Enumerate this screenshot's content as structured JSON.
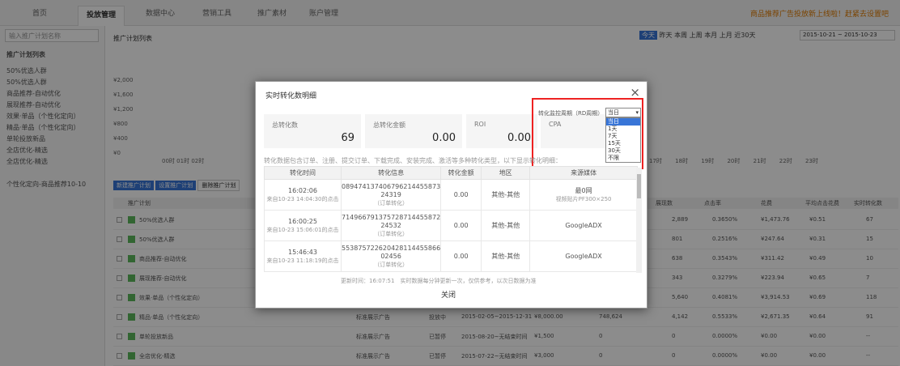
{
  "topnav": {
    "tabs": [
      "首页",
      "投放管理",
      "数据中心",
      "营销工具",
      "推广素材",
      "账户管理"
    ],
    "notice": "商品推荐广告投放新上线啦！赶紧去设置吧"
  },
  "sidebar": {
    "search_placeholder": "输入推广计划名称",
    "items": [
      "推广计划列表",
      "50%优选人群",
      "50%优选人群",
      "商品推荐-自动优化",
      "展现推荐-自动优化",
      "效果·单品（个性化定向）",
      "精品·单品（个性化定向）",
      "单轮投放新品",
      "全店优化-精选",
      "全店优化-精选",
      "个性化定向-商品推荐10-10"
    ]
  },
  "main": {
    "title": "推广计划列表",
    "range_buttons": [
      "今天",
      "昨天",
      "本周",
      "上周",
      "本月",
      "上月",
      "近30天"
    ],
    "date_range": "2015-10-21 ~ 2015-10-23",
    "y_ticks": [
      "¥2,000",
      "¥1,600",
      "¥1,200",
      "¥800",
      "¥400",
      "¥0"
    ],
    "hours": [
      "00时",
      "01时",
      "02时",
      "17时",
      "18时",
      "19时",
      "20时",
      "21时",
      "22时",
      "23时"
    ],
    "buttons": [
      "新建推广计划",
      "设置推广计划",
      "删除推广计划"
    ],
    "columns": [
      "推广计划",
      "投放类型",
      "状态",
      "投放日期",
      "日预算",
      "消耗",
      "展现数",
      "点击率",
      "花费",
      "平均点击花费",
      "实时转化数"
    ],
    "rows": [
      {
        "name": "50%优选人群",
        "show": "2,889",
        "ctr": "0.3650%",
        "cost": "¥1,473.76",
        "cpc": "¥0.51",
        "conv": "67"
      },
      {
        "name": "50%优选人群",
        "show": "801",
        "ctr": "0.2516%",
        "cost": "¥247.64",
        "cpc": "¥0.31",
        "conv": "15"
      },
      {
        "name": "商品推荐-自动优化",
        "show": "638",
        "ctr": "0.3543%",
        "cost": "¥311.42",
        "cpc": "¥0.49",
        "conv": "10"
      },
      {
        "name": "展现推荐-自动优化",
        "show": "343",
        "ctr": "0.3279%",
        "cost": "¥223.94",
        "cpc": "¥0.65",
        "conv": "7"
      },
      {
        "name": "效果·单品（个性化定向）",
        "show": "5,640",
        "ctr": "0.4081%",
        "cost": "¥3,914.53",
        "cpc": "¥0.69",
        "conv": "118"
      },
      {
        "name": "精品·单品（个性化定向）",
        "type": "标准展示广告",
        "status": "投放中",
        "date": "2015-02-05~2015-12-31",
        "budget": "¥8,000.00",
        "imp": "748,624",
        "show": "4,142",
        "ctr": "0.5533%",
        "cost": "¥2,671.35",
        "cpc": "¥0.64",
        "conv": "91"
      },
      {
        "name": "单轮投放新品",
        "type": "标准展示广告",
        "status": "已暂停",
        "date": "2015-08-20~无结束时间",
        "budget": "¥1,500",
        "imp": "0",
        "show": "0",
        "ctr": "0.0000%",
        "cost": "¥0.00",
        "cpc": "¥0.00",
        "conv": "--"
      },
      {
        "name": "全店优化-精选",
        "type": "标准展示广告",
        "status": "已暂停",
        "date": "2015-07-22~无结束时间",
        "budget": "¥3,000",
        "imp": "0",
        "show": "0",
        "ctr": "0.0000%",
        "cost": "¥0.00",
        "cpc": "¥0.00",
        "conv": "--"
      }
    ]
  },
  "modal": {
    "title": "实时转化数明细",
    "close": "×",
    "stats": [
      {
        "label": "总转化数",
        "value": "69"
      },
      {
        "label": "总转化金额",
        "value": "0.00"
      },
      {
        "label": "ROI",
        "value": "0.00"
      },
      {
        "label": "CPA",
        "value": ""
      }
    ],
    "period_label": "转化监控周期（RD周期）",
    "period_selected": "当日",
    "period_options": [
      "当日",
      "1天",
      "7天",
      "15天",
      "30天",
      "不限"
    ],
    "note": "转化数据包含订单、注册、提交订单、下载完成、安装完成、激活等多种转化类型，以下显示转化明细：",
    "columns": [
      "转化时间",
      "转化信息",
      "转化金额",
      "地区",
      "来源媒体"
    ],
    "rows": [
      {
        "time": "16:02:06",
        "time_sub": "来自10-23 14:04:30的点击",
        "info": "089474137406796214455873 24319",
        "info_sub": "（订单转化）",
        "amount": "0.00",
        "region": "其他-其他",
        "media": "最0网",
        "media_sub": "视频贴片PF300×250"
      },
      {
        "time": "16:00:25",
        "time_sub": "来自10-23 15:06:01的点击",
        "info": "714966791375728714455872 24532",
        "info_sub": "（订单转化）",
        "amount": "0.00",
        "region": "其他-其他",
        "media": "GoogleADX",
        "media_sub": ""
      },
      {
        "time": "15:46:43",
        "time_sub": "来自10-23 11:18:19的点击",
        "info": "553875722620428114455866 02456",
        "info_sub": "（订单转化）",
        "amount": "0.00",
        "region": "其他-其他",
        "media": "GoogleADX",
        "media_sub": ""
      }
    ],
    "update": "更新时间：16:07:51　实时数据每分钟更新一次，仅供参考，以次日数据为准",
    "close_btn": "关闭"
  }
}
